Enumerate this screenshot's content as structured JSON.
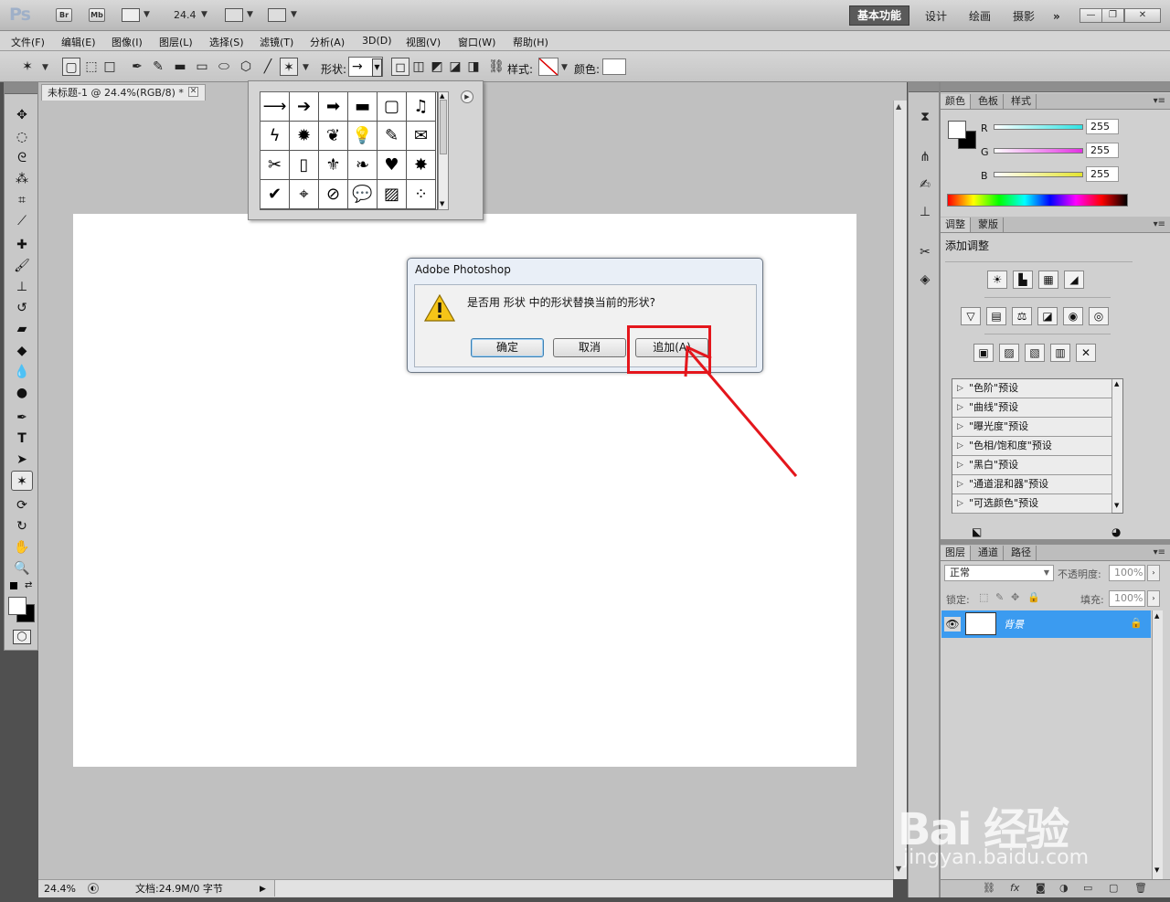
{
  "app": {
    "logo": "Ps",
    "bridge_label": "Br",
    "mini_bridge_label": "Mb",
    "zoom": "24.4",
    "workspaces": [
      "基本功能",
      "设计",
      "绘画",
      "摄影"
    ],
    "workspace_more": "»",
    "window_controls": [
      "—",
      "❐",
      "✕"
    ]
  },
  "menu": [
    "文件(F)",
    "编辑(E)",
    "图像(I)",
    "图层(L)",
    "选择(S)",
    "滤镜(T)",
    "分析(A)",
    "3D(D)",
    "视图(V)",
    "窗口(W)",
    "帮助(H)"
  ],
  "options": {
    "shape_label": "形状:",
    "shape_value": "→",
    "style_label": "样式:",
    "color_label": "颜色:"
  },
  "document": {
    "tab_title": "未标题-1 @ 24.4%(RGB/8) *",
    "close": "✕"
  },
  "status": {
    "zoom": "24.4%",
    "doc_info": "文档:24.9M/0 字节"
  },
  "shape_picker": {
    "shapes": [
      "⟶",
      "➔",
      "➡",
      "▬",
      "▢",
      "♫",
      "ϟ",
      "✹",
      "❦",
      "💡",
      "✎",
      "✉",
      "✂",
      "▯",
      "⚜",
      "❧",
      "♥",
      "✸",
      "✔",
      "⌖",
      "⊘",
      "💬",
      "▨",
      "⁘"
    ],
    "menu_icon": "▶"
  },
  "dialog": {
    "title": "Adobe Photoshop",
    "message": "是否用 形状 中的形状替换当前的形状?",
    "ok": "确定",
    "cancel": "取消",
    "append": "追加(A)"
  },
  "panels": {
    "color": {
      "tabs": [
        "颜色",
        "色板",
        "样式"
      ],
      "channels": [
        {
          "label": "R",
          "value": "255",
          "color": "#2fe3e3"
        },
        {
          "label": "G",
          "value": "255",
          "color": "#e32fe3"
        },
        {
          "label": "B",
          "value": "255",
          "color": "#e3e32f"
        }
      ]
    },
    "adjustments": {
      "tabs": [
        "调整",
        "蒙版"
      ],
      "title": "添加调整",
      "icons_row1": [
        "☀",
        "▙",
        "▦",
        "◢"
      ],
      "icons_row2": [
        "▽",
        "▤",
        "⚖",
        "◪",
        "◉",
        "◎"
      ],
      "icons_row3": [
        "▣",
        "▨",
        "▧",
        "▥",
        "✕"
      ],
      "presets": [
        "\"色阶\"预设",
        "\"曲线\"预设",
        "\"曝光度\"预设",
        "\"色相/饱和度\"预设",
        "\"黑白\"预设",
        "\"通道混和器\"预设",
        "\"可选颜色\"预设"
      ]
    },
    "layers": {
      "tabs": [
        "图层",
        "通道",
        "路径"
      ],
      "blend_mode": "正常",
      "opacity_label": "不透明度:",
      "opacity": "100%",
      "lock_label": "锁定:",
      "fill_label": "填充:",
      "fill": "100%",
      "layer_name": "背景"
    }
  },
  "watermark": {
    "brand": "Bai 经验",
    "url": "jingyan.baidu.com"
  },
  "colors": {
    "highlight": "#e4161c",
    "layer_selected": "#3b9bf0",
    "workspace_active": "#5a5a5a"
  }
}
